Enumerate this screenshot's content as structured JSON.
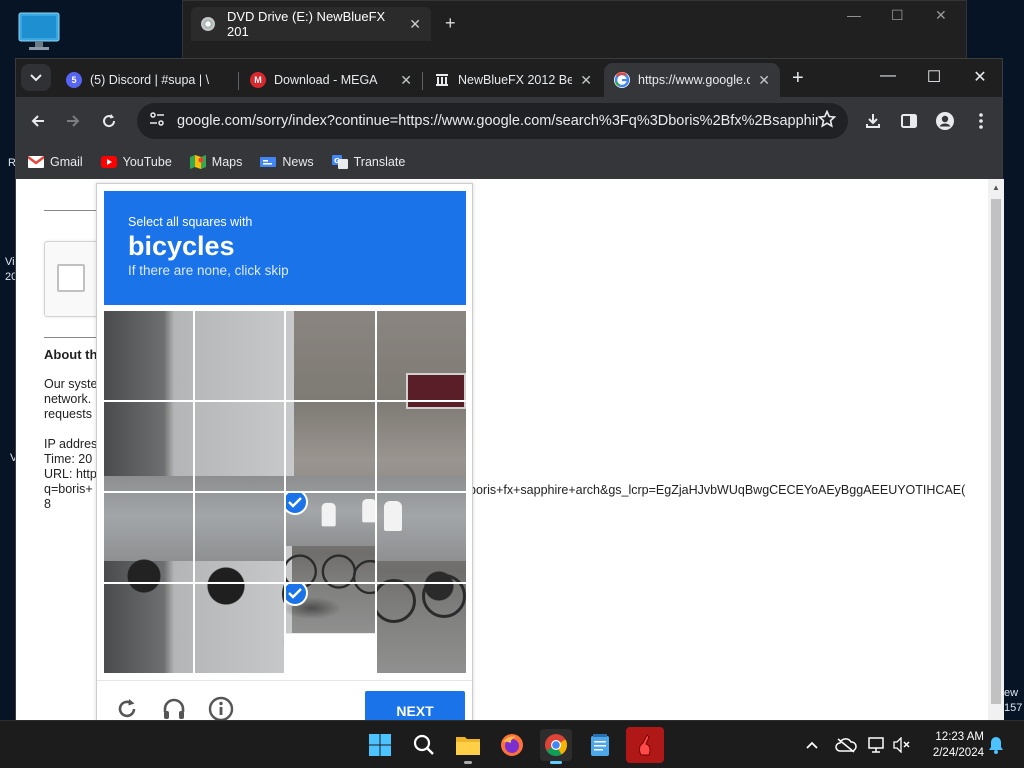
{
  "desktop": {
    "frag_r": "R",
    "frag_vi": "Vi",
    "frag_20": "20",
    "frag_v": "V",
    "frag_ew": "ew",
    "frag_157": "157"
  },
  "explorer": {
    "tab_title": "DVD Drive (E:) NewBlueFX 201",
    "close": "✕",
    "new_tab": "+"
  },
  "chrome": {
    "tabs": [
      {
        "label": "(5) Discord | #supa | \\",
        "favicon_text": "5",
        "favicon_color": "#5865f2"
      },
      {
        "label": "Download - MEGA",
        "favicon_text": "M",
        "favicon_color": "#d9272e"
      },
      {
        "label": "NewBlueFX 2012 Bet",
        "favicon_text": "",
        "favicon_color": "#e8eaed"
      },
      {
        "label": "https://www.google.c",
        "favicon_text": "G",
        "favicon_color": "#ffffff"
      }
    ],
    "tab_close": "✕",
    "new_tab": "+",
    "url": "google.com/sorry/index?continue=https://www.google.com/search%3Fq%3Dboris%2Bfx%2Bsapphir...",
    "bookmarks": [
      {
        "label": "Gmail",
        "icon": "gmail-icon"
      },
      {
        "label": "YouTube",
        "icon": "youtube-icon"
      },
      {
        "label": "Maps",
        "icon": "maps-icon"
      },
      {
        "label": "News",
        "icon": "news-icon"
      },
      {
        "label": "Translate",
        "icon": "translate-icon"
      }
    ]
  },
  "page": {
    "about_heading": "About th",
    "line1": "Our syste",
    "line2": "network.",
    "line3": "requests",
    "ip": "IP addres",
    "time": "Time: 20",
    "url_label": "URL: http",
    "url_q": "q=boris+",
    "url_8": "8",
    "url_rest": "boris+fx+sapphire+arch&gs_lcrp=EgZjaHJvbWUqBwgCECEYoAEyBggAEEUYOTIHCAE("
  },
  "captcha": {
    "instruction": "Select all squares with",
    "object": "bicycles",
    "skip_hint": "If there are none, click skip",
    "selected_tiles": [
      10,
      14
    ],
    "next_label": "NEXT",
    "accent_color": "#1a73e8"
  },
  "taskbar": {
    "time": "12:23 AM",
    "date": "2/24/2024"
  }
}
